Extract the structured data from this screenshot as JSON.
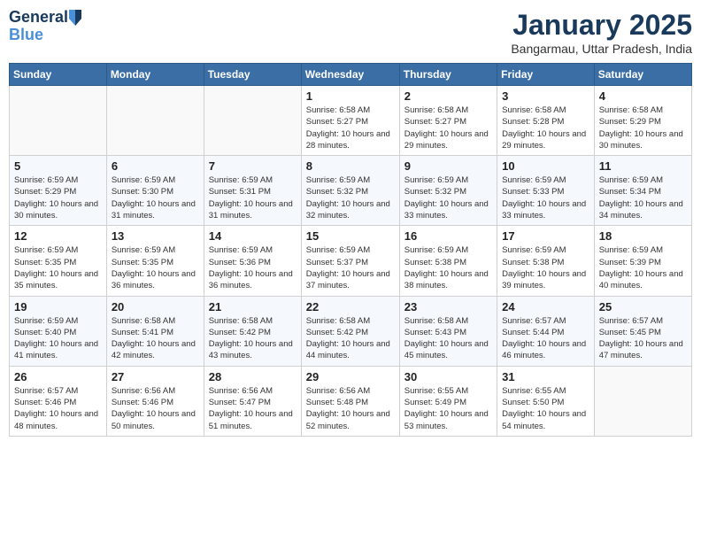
{
  "header": {
    "logo_line1": "General",
    "logo_line2": "Blue",
    "month": "January 2025",
    "location": "Bangarmau, Uttar Pradesh, India"
  },
  "days_of_week": [
    "Sunday",
    "Monday",
    "Tuesday",
    "Wednesday",
    "Thursday",
    "Friday",
    "Saturday"
  ],
  "weeks": [
    [
      {
        "day": "",
        "detail": ""
      },
      {
        "day": "",
        "detail": ""
      },
      {
        "day": "",
        "detail": ""
      },
      {
        "day": "1",
        "detail": "Sunrise: 6:58 AM\nSunset: 5:27 PM\nDaylight: 10 hours\nand 28 minutes."
      },
      {
        "day": "2",
        "detail": "Sunrise: 6:58 AM\nSunset: 5:27 PM\nDaylight: 10 hours\nand 29 minutes."
      },
      {
        "day": "3",
        "detail": "Sunrise: 6:58 AM\nSunset: 5:28 PM\nDaylight: 10 hours\nand 29 minutes."
      },
      {
        "day": "4",
        "detail": "Sunrise: 6:58 AM\nSunset: 5:29 PM\nDaylight: 10 hours\nand 30 minutes."
      }
    ],
    [
      {
        "day": "5",
        "detail": "Sunrise: 6:59 AM\nSunset: 5:29 PM\nDaylight: 10 hours\nand 30 minutes."
      },
      {
        "day": "6",
        "detail": "Sunrise: 6:59 AM\nSunset: 5:30 PM\nDaylight: 10 hours\nand 31 minutes."
      },
      {
        "day": "7",
        "detail": "Sunrise: 6:59 AM\nSunset: 5:31 PM\nDaylight: 10 hours\nand 31 minutes."
      },
      {
        "day": "8",
        "detail": "Sunrise: 6:59 AM\nSunset: 5:32 PM\nDaylight: 10 hours\nand 32 minutes."
      },
      {
        "day": "9",
        "detail": "Sunrise: 6:59 AM\nSunset: 5:32 PM\nDaylight: 10 hours\nand 33 minutes."
      },
      {
        "day": "10",
        "detail": "Sunrise: 6:59 AM\nSunset: 5:33 PM\nDaylight: 10 hours\nand 33 minutes."
      },
      {
        "day": "11",
        "detail": "Sunrise: 6:59 AM\nSunset: 5:34 PM\nDaylight: 10 hours\nand 34 minutes."
      }
    ],
    [
      {
        "day": "12",
        "detail": "Sunrise: 6:59 AM\nSunset: 5:35 PM\nDaylight: 10 hours\nand 35 minutes."
      },
      {
        "day": "13",
        "detail": "Sunrise: 6:59 AM\nSunset: 5:35 PM\nDaylight: 10 hours\nand 36 minutes."
      },
      {
        "day": "14",
        "detail": "Sunrise: 6:59 AM\nSunset: 5:36 PM\nDaylight: 10 hours\nand 36 minutes."
      },
      {
        "day": "15",
        "detail": "Sunrise: 6:59 AM\nSunset: 5:37 PM\nDaylight: 10 hours\nand 37 minutes."
      },
      {
        "day": "16",
        "detail": "Sunrise: 6:59 AM\nSunset: 5:38 PM\nDaylight: 10 hours\nand 38 minutes."
      },
      {
        "day": "17",
        "detail": "Sunrise: 6:59 AM\nSunset: 5:38 PM\nDaylight: 10 hours\nand 39 minutes."
      },
      {
        "day": "18",
        "detail": "Sunrise: 6:59 AM\nSunset: 5:39 PM\nDaylight: 10 hours\nand 40 minutes."
      }
    ],
    [
      {
        "day": "19",
        "detail": "Sunrise: 6:59 AM\nSunset: 5:40 PM\nDaylight: 10 hours\nand 41 minutes."
      },
      {
        "day": "20",
        "detail": "Sunrise: 6:58 AM\nSunset: 5:41 PM\nDaylight: 10 hours\nand 42 minutes."
      },
      {
        "day": "21",
        "detail": "Sunrise: 6:58 AM\nSunset: 5:42 PM\nDaylight: 10 hours\nand 43 minutes."
      },
      {
        "day": "22",
        "detail": "Sunrise: 6:58 AM\nSunset: 5:42 PM\nDaylight: 10 hours\nand 44 minutes."
      },
      {
        "day": "23",
        "detail": "Sunrise: 6:58 AM\nSunset: 5:43 PM\nDaylight: 10 hours\nand 45 minutes."
      },
      {
        "day": "24",
        "detail": "Sunrise: 6:57 AM\nSunset: 5:44 PM\nDaylight: 10 hours\nand 46 minutes."
      },
      {
        "day": "25",
        "detail": "Sunrise: 6:57 AM\nSunset: 5:45 PM\nDaylight: 10 hours\nand 47 minutes."
      }
    ],
    [
      {
        "day": "26",
        "detail": "Sunrise: 6:57 AM\nSunset: 5:46 PM\nDaylight: 10 hours\nand 48 minutes."
      },
      {
        "day": "27",
        "detail": "Sunrise: 6:56 AM\nSunset: 5:46 PM\nDaylight: 10 hours\nand 50 minutes."
      },
      {
        "day": "28",
        "detail": "Sunrise: 6:56 AM\nSunset: 5:47 PM\nDaylight: 10 hours\nand 51 minutes."
      },
      {
        "day": "29",
        "detail": "Sunrise: 6:56 AM\nSunset: 5:48 PM\nDaylight: 10 hours\nand 52 minutes."
      },
      {
        "day": "30",
        "detail": "Sunrise: 6:55 AM\nSunset: 5:49 PM\nDaylight: 10 hours\nand 53 minutes."
      },
      {
        "day": "31",
        "detail": "Sunrise: 6:55 AM\nSunset: 5:50 PM\nDaylight: 10 hours\nand 54 minutes."
      },
      {
        "day": "",
        "detail": ""
      }
    ]
  ]
}
